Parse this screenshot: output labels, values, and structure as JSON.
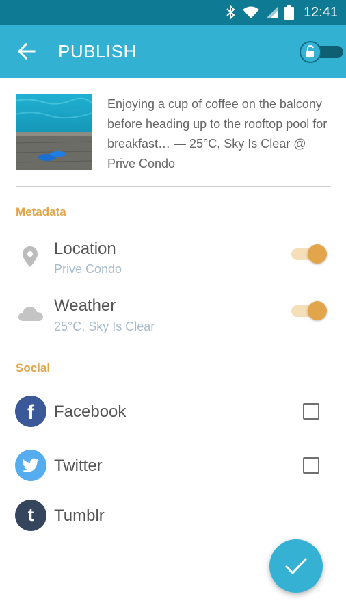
{
  "status_bar": {
    "time": "12:41",
    "icons": [
      "bluetooth-icon",
      "wifi-icon",
      "cell-signal-icon",
      "battery-icon"
    ]
  },
  "app_bar": {
    "title": "PUBLISH",
    "back_icon": "arrow-left-icon",
    "lock_toggle_icon": "unlock-icon"
  },
  "post": {
    "text": "Enjoying a cup of coffee on the balcony before heading up to the rooftop pool for breakfast… — 25°C, Sky Is Clear @ Prive Condo"
  },
  "metadata": {
    "header": "Metadata",
    "items": [
      {
        "title": "Location",
        "subtitle": "Prive Condo",
        "icon": "location-pin-icon",
        "enabled": true
      },
      {
        "title": "Weather",
        "subtitle": "25°C, Sky Is Clear",
        "icon": "cloud-icon",
        "enabled": true
      }
    ]
  },
  "social": {
    "header": "Social",
    "items": [
      {
        "name": "Facebook",
        "letter": "f",
        "icon": "facebook-icon",
        "checked": false
      },
      {
        "name": "Twitter",
        "icon": "twitter-icon",
        "checked": false
      },
      {
        "name": "Tumblr",
        "letter": "t",
        "icon": "tumblr-icon"
      }
    ]
  },
  "colors": {
    "status_bar": "#0f7a93",
    "app_bar": "#33b1d2",
    "accent": "#e2a54b",
    "facebook": "#3b5998",
    "twitter": "#55acee",
    "tumblr": "#35465c"
  },
  "fab": {
    "icon": "check-icon"
  }
}
